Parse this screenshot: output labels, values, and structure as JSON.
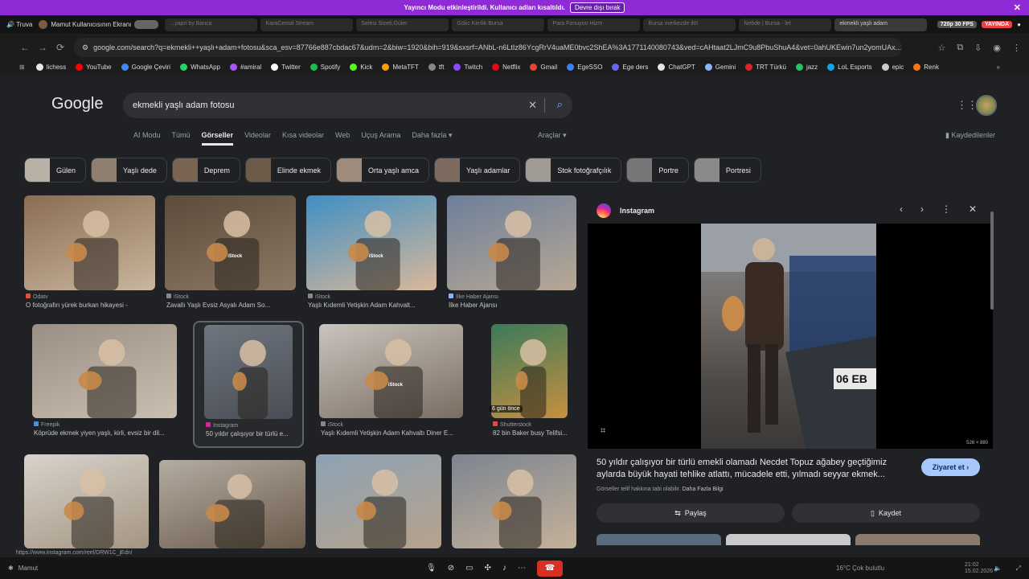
{
  "banner": {
    "text": "Yayıncı Modu etkinleştirildi. Kullanıcı adları kısaltıldı.",
    "button": "Devre dışı bırak"
  },
  "topbar": {
    "app": "Truva",
    "user": "Mamut Kullanıcısının Ekranı",
    "tabs": [
      "...yapıt by Banca",
      "KaraCemal Stream",
      "Selesi Sizeti,Güler",
      "Gökc Kimlik Bursa",
      "Para Fonuyon Hizm",
      "Bursa merkezde ilöl",
      "Nebde | Bursa - let",
      "ekmekli yaşlı adam"
    ],
    "quality": "720p 30 FPS",
    "live": "YAYINDA"
  },
  "address": {
    "url": "google.com/search?q=ekmekli++yaşlı+adam+fotosu&sca_esv=87766e887cbdac67&udm=2&biw=1920&bih=919&sxsrf=ANbL-n6LtIz86YcgRrV4uaME0bvc2ShEA%3A1771140080743&ved=cAHtaat2LJmC9u8PbuShuA4&vet=0ahUKEwin7un2yomUAx..."
  },
  "bookmarks": [
    {
      "label": "lichess",
      "color": "#e8e8e8"
    },
    {
      "label": "YouTube",
      "color": "#ff0000"
    },
    {
      "label": "Google Çeviri",
      "color": "#4285f4"
    },
    {
      "label": "WhatsApp",
      "color": "#25d366"
    },
    {
      "label": "#amiral",
      "color": "#a855f7"
    },
    {
      "label": "Twitter",
      "color": "#ffffff"
    },
    {
      "label": "Spotify",
      "color": "#1db954"
    },
    {
      "label": "Kick",
      "color": "#53fc18"
    },
    {
      "label": "MetaTFT",
      "color": "#f59e0b"
    },
    {
      "label": "tft",
      "color": "#888888"
    },
    {
      "label": "Twitch",
      "color": "#9146ff"
    },
    {
      "label": "Netflix",
      "color": "#e50914"
    },
    {
      "label": "Gmail",
      "color": "#ea4335"
    },
    {
      "label": "EgeSSO",
      "color": "#3b82f6"
    },
    {
      "label": "Ege ders",
      "color": "#6366f1"
    },
    {
      "label": "ChatGPT",
      "color": "#e5e5e5"
    },
    {
      "label": "Gemini",
      "color": "#8ab4f8"
    },
    {
      "label": "TRT Türkü",
      "color": "#dc2626"
    },
    {
      "label": "jazz",
      "color": "#22c55e"
    },
    {
      "label": "LoL Esports",
      "color": "#0ea5e9"
    },
    {
      "label": "epic",
      "color": "#cccccc"
    },
    {
      "label": "Renk",
      "color": "#f97316"
    }
  ],
  "google": {
    "logo": "Google",
    "query": "ekmekli yaşlı adam fotosu",
    "tabs": [
      "AI Modu",
      "Tümü",
      "Görseller",
      "Videolar",
      "Kısa videolar",
      "Web",
      "Uçuş Arama",
      "Daha fazla ▾"
    ],
    "active_tab": "Görseller",
    "tools": "Araçlar ▾",
    "saved": "Kaydedilenler",
    "chips": [
      {
        "label": "Gülen",
        "color": "#b9b1a6"
      },
      {
        "label": "Yaşlı dede",
        "color": "#8e7f70"
      },
      {
        "label": "Deprem",
        "color": "#7a6552"
      },
      {
        "label": "Elinde ekmek",
        "color": "#6d5a48"
      },
      {
        "label": "Orta yaşlı amca",
        "color": "#9e8b7b"
      },
      {
        "label": "Yaşlı adamlar",
        "color": "#7c6b5e"
      },
      {
        "label": "Stok fotoğrafçılık",
        "color": "#a09a94"
      },
      {
        "label": "Portre",
        "color": "#777777"
      },
      {
        "label": "Portresi",
        "color": "#8a8a8a"
      }
    ]
  },
  "results": [
    {
      "source": "Odatv",
      "caption": "O fotoğrafın yürek burkan hikayesi -",
      "color": "#8a6d52",
      "color2": "#c9b69e",
      "src_color": "#e74c3c"
    },
    {
      "source": "iStock",
      "caption": "Zavallı Yaşlı Evsiz Asyalı Adam So...",
      "color": "#5c4b3b",
      "color2": "#8c7864",
      "src_color": "#888888"
    },
    {
      "source": "iStock",
      "caption": "Yaşlı Kıdemli Yetişkin Adam Kahvalt...",
      "color": "#3f8fc4",
      "color2": "#d9b89a",
      "src_color": "#888888"
    },
    {
      "source": "İlke Haber Ajansı",
      "caption": "İlke Haber Ajansı",
      "color": "#6d7f9a",
      "color2": "#b8a895",
      "src_color": "#8ab4f8"
    },
    {
      "source": "Freepik",
      "caption": "Köprüde ekmek yiyen yaşlı, kirli, evsiz bir dil...",
      "color": "#9a8f84",
      "color2": "#cbbfb0",
      "src_color": "#4a90e2"
    },
    {
      "source": "Instagram",
      "caption": "50 yıldır çalışıyor bir türlü e...",
      "color": "#6e7680",
      "color2": "#4a4d55",
      "src_color": "#d6249f"
    },
    {
      "source": "iStock",
      "caption": "Yaşlı Kıdemli Yetişkin Adam Kahvaltı Diner E...",
      "color": "#c9c4bd",
      "color2": "#7a6d62",
      "src_color": "#888888"
    },
    {
      "source": "Shutterstock",
      "caption": "82 bin Baker busy Telifsi...",
      "color": "#3b7a5a",
      "color2": "#c6903f",
      "src_color": "#ef4444"
    },
    {
      "source": "",
      "caption": "",
      "color": "#d8d3cc",
      "color2": "#a59582",
      "src_color": "#888888"
    },
    {
      "source": "",
      "caption": "",
      "color": "#b4aca2",
      "color2": "#6a5a4a",
      "src_color": "#888888"
    },
    {
      "source": "",
      "caption": "",
      "color": "#8da2b4",
      "color2": "#b7a28c",
      "src_color": "#888888"
    },
    {
      "source": "",
      "caption": "",
      "color": "#7d8590",
      "color2": "#c5b19a",
      "src_color": "#888888"
    }
  ],
  "badge_time": "6 gün önce",
  "istock_wm": "iStock",
  "panel": {
    "source": "Instagram",
    "size": "526 × 880",
    "title": "50 yıldır çalışıyor bir türlü emekli olamadı Necdet Topuz ağabey geçtiğimiz aylarda büyük hayati tehlike atlattı, mücadele etti, yılmadı seyyar ekmek...",
    "visit": "Ziyaret et ›",
    "note": "Görseller telif hakkına tabi olabilir.",
    "note_link": "Daha Fazla Bilgi",
    "share": "Paylaş",
    "save": "Kaydet",
    "plate": "06 EB"
  },
  "status_url": "https://www.instagram.com/reel/DRW1C_jEdn/",
  "taskbar": {
    "user": "Mamut",
    "weather": "16°C  Çok bulutlu",
    "time": "21:02",
    "date": "15.02.2026"
  }
}
